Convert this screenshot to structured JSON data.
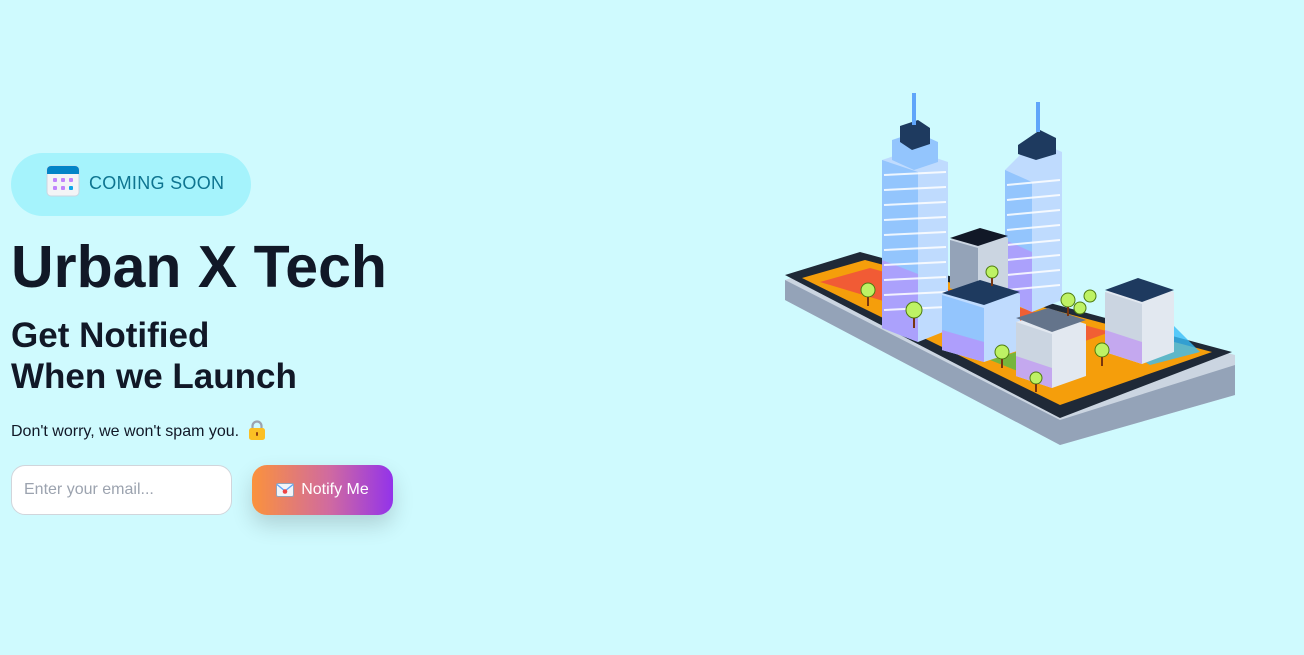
{
  "badge": {
    "icon": "calendar-icon",
    "label": "COMING SOON"
  },
  "hero": {
    "title": "Urban X Tech",
    "subtitle_line1": "Get Notified",
    "subtitle_line2": "When we Launch",
    "illustration": "smartphone-city-illustration"
  },
  "notice": {
    "text": "Don't worry, we won't spam you.",
    "icon": "lock-icon"
  },
  "form": {
    "email_placeholder": "Enter your email...",
    "email_value": "",
    "button_label": "Notify Me",
    "button_icon": "envelope-icon"
  },
  "colors": {
    "background": "#cffafe",
    "badge_background": "#a5f3fc",
    "badge_text": "#0e7490",
    "heading": "#111827",
    "button_gradient_start": "#fb923c",
    "button_gradient_end": "#9333ea"
  }
}
